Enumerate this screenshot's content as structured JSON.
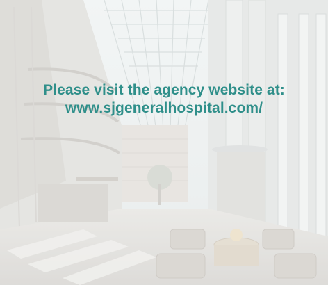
{
  "notice": {
    "line1": "Please visit the agency website at:",
    "line2": "www.sjgeneralhospital.com/"
  },
  "background": {
    "subject": "hospital atrium lobby with glass skylight roof and lounge chairs",
    "tint": "washed-out (faded) photograph"
  },
  "colors": {
    "text_accent": "#2f8f8a"
  }
}
